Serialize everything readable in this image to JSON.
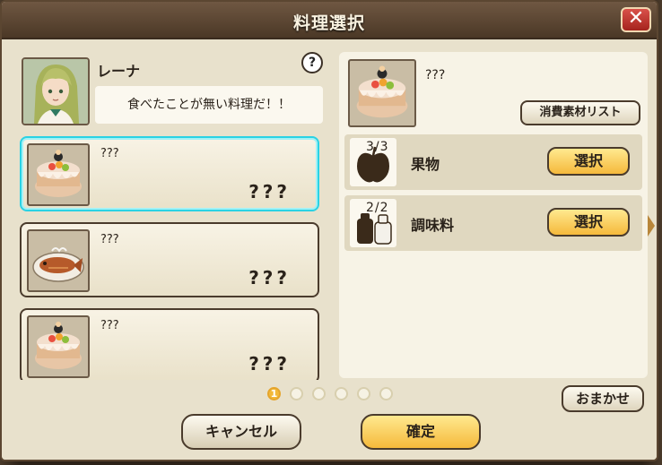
{
  "window": {
    "title": "料理選択",
    "close_label": "✕"
  },
  "help_label": "?",
  "character": {
    "name": "レーナ",
    "speech": "食べたことが無い料理だ！！"
  },
  "recipes": [
    {
      "name": "???",
      "subtitle": "???",
      "icon": "cake-icon"
    },
    {
      "name": "???",
      "subtitle": "???",
      "icon": "grilled-fish-icon"
    },
    {
      "name": "???",
      "subtitle": "???",
      "icon": "cake-icon"
    }
  ],
  "detail": {
    "name": "???",
    "icon": "cake-icon",
    "material_list_label": "消費素材リスト",
    "ingredients": [
      {
        "count": "3/3",
        "name": "果物",
        "select_label": "選択",
        "icon": "apple-icon"
      },
      {
        "count": "2/2",
        "name": "調味料",
        "select_label": "選択",
        "icon": "seasoning-bottles-icon"
      }
    ]
  },
  "pagination": {
    "current": "1",
    "total": 6
  },
  "buttons": {
    "omakase": "おまかせ",
    "cancel": "キャンセル",
    "confirm": "確定"
  },
  "colors": {
    "accent_gold": "#f5b93b",
    "selected_border": "#2ad2e4",
    "close_red": "#c0322b"
  }
}
